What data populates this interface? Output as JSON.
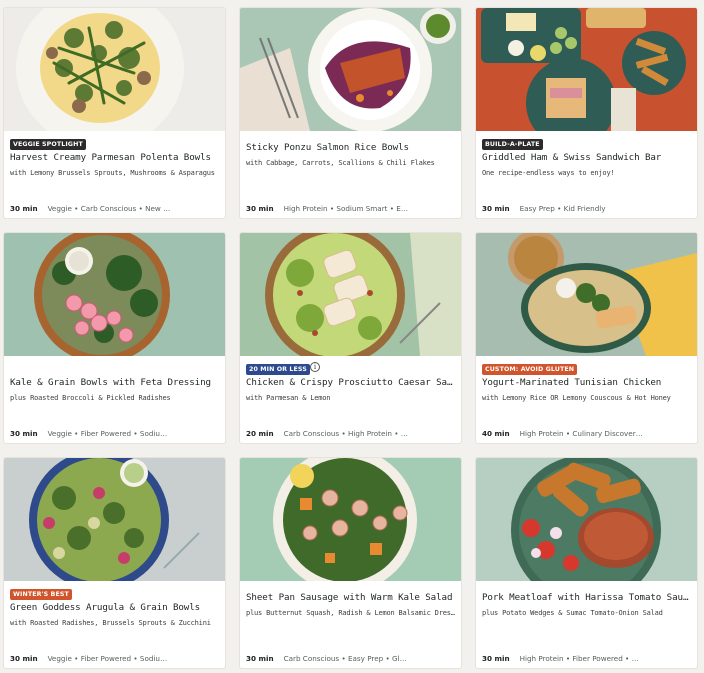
{
  "recipes": [
    {
      "badge": "VEGGIE SPOTLIGHT",
      "title": "Harvest Creamy Parmesan Polenta Bowls",
      "subtitle": "with Lemony Brussels Sprouts, Mushrooms & Asparagus",
      "time": "30 min",
      "tags": "Veggie • Carb Conscious • New …"
    },
    {
      "badge": "",
      "title": "Sticky Ponzu Salmon Rice Bowls",
      "subtitle": "with Cabbage, Carrots, Scallions & Chili Flakes",
      "time": "30 min",
      "tags": "High Protein • Sodium Smart • E…"
    },
    {
      "badge": "BUILD-A-PLATE",
      "title": "Griddled Ham & Swiss Sandwich Bar",
      "subtitle": "One recipe-endless ways to enjoy!",
      "time": "30 min",
      "tags": "Easy Prep • Kid Friendly"
    },
    {
      "badge": "",
      "title": "Kale & Grain Bowls with Feta Dressing",
      "subtitle": "plus Roasted Broccoli & Pickled Radishes",
      "time": "30 min",
      "tags": "Veggie • Fiber Powered • Sodiu…"
    },
    {
      "badge": "20 MIN OR LESS",
      "title": "Chicken & Crispy Prosciutto Caesar Salad",
      "subtitle": "with Parmesan & Lemon",
      "time": "20 min",
      "tags": "Carb Conscious • High Protein • …"
    },
    {
      "badge": "CUSTOM: AVOID GLUTEN",
      "title": "Yogurt-Marinated Tunisian Chicken",
      "subtitle": "with Lemony Rice OR Lemony Couscous & Hot Honey",
      "time": "40 min",
      "tags": "High Protein • Culinary Discover…"
    },
    {
      "badge": "WINTER'S BEST",
      "title": "Green Goddess Arugula & Grain Bowls",
      "subtitle": "with Roasted Radishes, Brussels Sprouts & Zucchini",
      "time": "30 min",
      "tags": "Veggie • Fiber Powered • Sodiu…"
    },
    {
      "badge": "",
      "title": "Sheet Pan Sausage with Warm Kale Salad",
      "subtitle": "plus Butternut Squash, Radish & Lemon Balsamic Dressing",
      "time": "30 min",
      "tags": "Carb Conscious • Easy Prep • Gl…"
    },
    {
      "badge": "",
      "title": "Pork Meatloaf with Harissa Tomato Sauce",
      "subtitle": "plus Potato Wedges & Sumac Tomato-Onion Salad",
      "time": "30 min",
      "tags": "High Protein • Fiber Powered • …"
    }
  ],
  "info_icon": "i",
  "colors": {
    "badge_dark": "#2b2b2b",
    "badge_blue": "#2d4a8f",
    "badge_orange": "#d0552c",
    "background": "#f3f1ee"
  }
}
